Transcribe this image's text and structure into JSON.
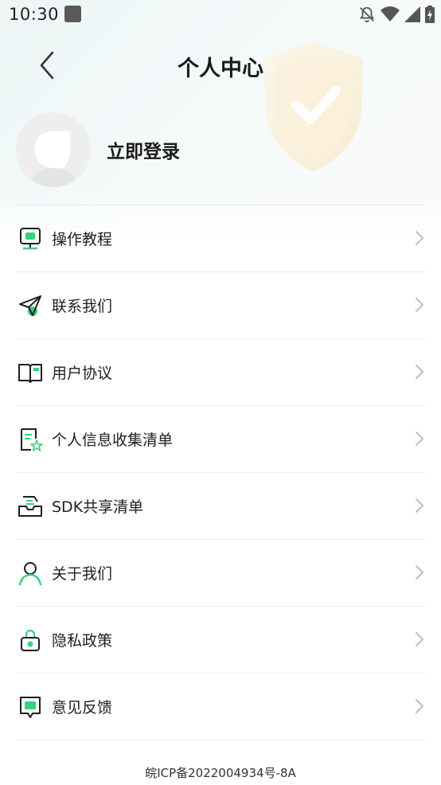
{
  "status_bar": {
    "time": "10:30",
    "icons": [
      "app-icon",
      "notification-off-icon",
      "wifi-icon",
      "signal-icon",
      "battery-charging-icon"
    ]
  },
  "header": {
    "title": "个人中心",
    "back_icon": "chevron-left-icon"
  },
  "profile": {
    "login_label": "立即登录",
    "avatar_icon": "default-avatar-icon"
  },
  "menu": {
    "items": [
      {
        "label": "操作教程",
        "icon": "monitor-icon"
      },
      {
        "label": "联系我们",
        "icon": "paper-plane-icon"
      },
      {
        "label": "用户协议",
        "icon": "open-book-icon"
      },
      {
        "label": "个人信息收集清单",
        "icon": "document-star-icon"
      },
      {
        "label": "SDK共享清单",
        "icon": "inbox-tray-icon"
      },
      {
        "label": "关于我们",
        "icon": "person-icon"
      },
      {
        "label": "隐私政策",
        "icon": "lock-icon"
      },
      {
        "label": "意见反馈",
        "icon": "feedback-chat-icon"
      }
    ]
  },
  "footer": {
    "icp": "皖ICP备2022004934号-8A"
  },
  "colors": {
    "accent": "#3ccf7e",
    "icon_stroke": "#1e1e1e",
    "chevron": "#bfbfbf"
  }
}
